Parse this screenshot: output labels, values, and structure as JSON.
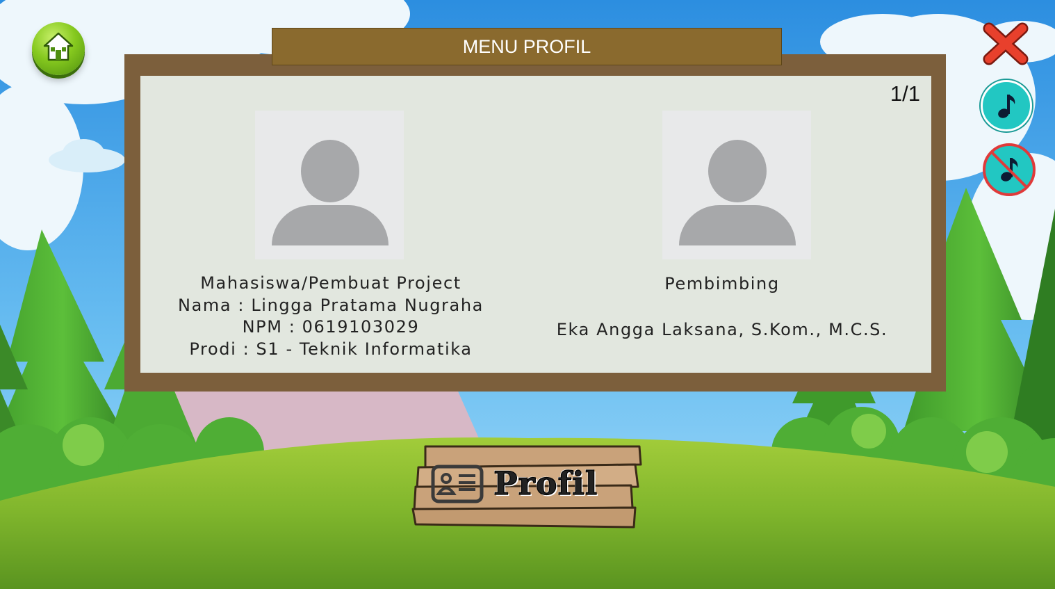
{
  "window": {
    "title": "MENU PROFIL",
    "page_indicator": "1/1"
  },
  "profiles": [
    {
      "role": "Mahasiswa/Pembuat Project",
      "name_line": "Nama : Lingga Pratama Nugraha",
      "npm_line": "NPM : 0619103029",
      "prodi_line": "Prodi : S1 - Teknik Informatika"
    },
    {
      "role": "Pembimbing",
      "name_line": "Eka Angga Laksana, S.Kom., M.C.S."
    }
  ],
  "controls": {
    "home": "home-icon",
    "close": "close-icon",
    "music_on": "music-note-icon",
    "music_off": "music-mute-icon"
  },
  "sign": {
    "label": "Profil",
    "icon": "id-card-icon"
  },
  "colors": {
    "title_bar": "#8a6a2e",
    "board_frame": "#7c5f3c",
    "panel": "#e2e7df",
    "music_button": "#22c7c2",
    "close_red": "#e8402c"
  }
}
